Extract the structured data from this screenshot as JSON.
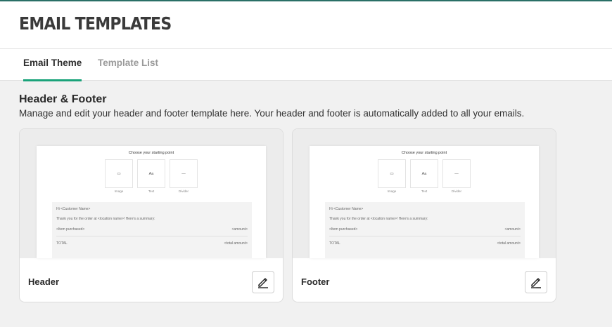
{
  "page": {
    "title": "EMAIL TEMPLATES"
  },
  "tabs": [
    {
      "label": "Email Theme",
      "active": true
    },
    {
      "label": "Template List",
      "active": false
    }
  ],
  "section": {
    "title": "Header & Footer",
    "description": "Manage and edit your header and footer template here. Your header and footer is automatically added to all your emails."
  },
  "preview": {
    "choose_label": "Choose your starting point",
    "options": [
      {
        "glyph": "▭",
        "label": "Image",
        "icon": "image-icon"
      },
      {
        "glyph": "Aa",
        "label": "Text",
        "icon": "text-icon"
      },
      {
        "glyph": "—",
        "label": "Divider",
        "icon": "divider-icon"
      }
    ],
    "greeting": "Hi <Customer Name>",
    "thanks": "Thank you for the order at <location name>! Here's a summary:",
    "item": "<Item purchased>",
    "amount": "<amount>",
    "total_label": "TOTAL",
    "total_amount": "<total amount>"
  },
  "cards": [
    {
      "label": "Header",
      "edit_icon": "pencil-icon"
    },
    {
      "label": "Footer",
      "edit_icon": "pencil-icon"
    }
  ],
  "colors": {
    "accent": "#1aa37a",
    "topline": "#2a6f66"
  }
}
